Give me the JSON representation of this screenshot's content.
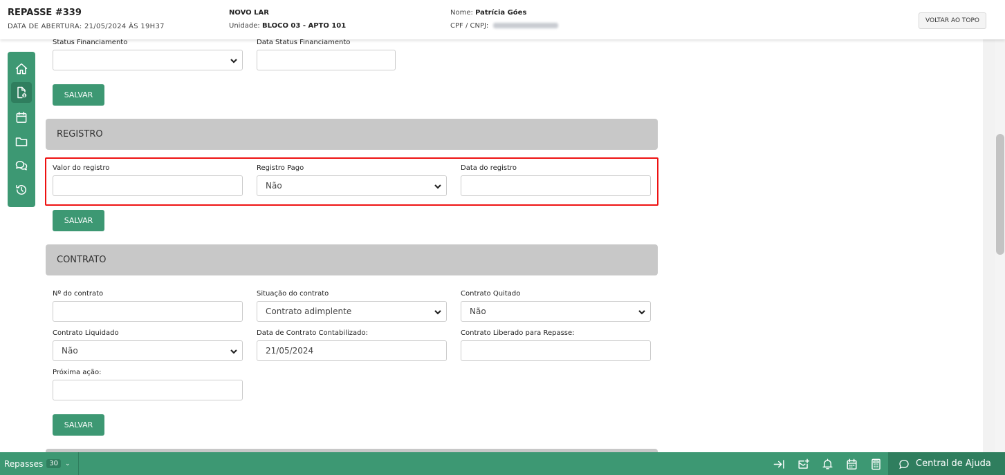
{
  "header": {
    "title": "REPASSE #339",
    "opening_date": "DATA DE ABERTURA: 21/05/2024 ÀS 19H37",
    "company": "NOVO LAR",
    "unit_label": "Unidade:",
    "unit_value": "BLOCO 03 - APTO 101",
    "name_label": "Nome:",
    "name_value": "Patrícia Góes",
    "cpf_label": "CPF / CNPJ:",
    "back_to_top": "VOLTAR AO TOPO"
  },
  "sidebar": {
    "items": [
      {
        "icon": "home-icon"
      },
      {
        "icon": "document-icon",
        "active": true
      },
      {
        "icon": "calendar-icon"
      },
      {
        "icon": "folder-icon"
      },
      {
        "icon": "chat-icon"
      },
      {
        "icon": "history-icon"
      }
    ]
  },
  "financing": {
    "status_label": "Status Financiamento",
    "status_value": "",
    "date_label": "Data Status Financiamento",
    "date_value": "",
    "save_label": "SALVAR"
  },
  "registro": {
    "title": "REGISTRO",
    "valor_label": "Valor do registro",
    "valor_value": "",
    "pago_label": "Registro Pago",
    "pago_value": "Não",
    "data_label": "Data do registro",
    "data_value": "",
    "save_label": "SALVAR"
  },
  "contrato": {
    "title": "CONTRATO",
    "numero_label": "Nº do contrato",
    "numero_value": "",
    "situacao_label": "Situação do contrato",
    "situacao_value": "Contrato adimplente",
    "quitado_label": "Contrato Quitado",
    "quitado_value": "Não",
    "liquidado_label": "Contrato Liquidado",
    "liquidado_value": "Não",
    "contabilizado_label": "Data de Contrato Contabilizado:",
    "contabilizado_value": "21/05/2024",
    "liberado_label": "Contrato Liberado para Repasse:",
    "liberado_value": "",
    "proxima_label": "Próxima ação:",
    "proxima_value": "",
    "save_label": "SALVAR"
  },
  "bottombar": {
    "repasses_label": "Repasses",
    "repasses_count": "30",
    "help_label": "Central de Ajuda",
    "icons": [
      "collapse-right-icon",
      "notification-mail-icon",
      "bell-icon",
      "calendar-icon",
      "calculator-icon"
    ]
  },
  "colors": {
    "brand_green": "#3d9873",
    "brand_green_dark": "#2f7e5e",
    "section_gray": "#c8c8c8",
    "highlight_red": "#e11111"
  }
}
